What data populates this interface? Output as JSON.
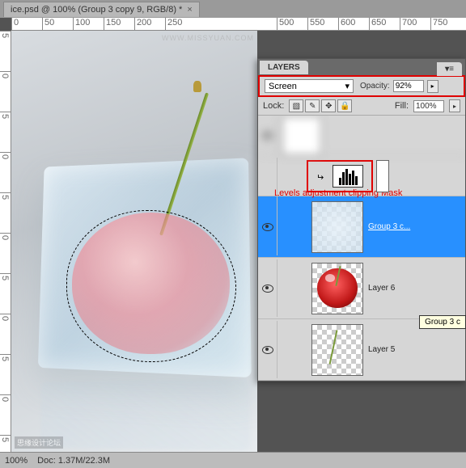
{
  "tab": {
    "title": "ice.psd @ 100% (Group 3 copy 9, RGB/8) *",
    "close": "×"
  },
  "ruler_h": [
    "0",
    "50",
    "100",
    "150",
    "200",
    "250",
    "500",
    "550",
    "600",
    "650",
    "700",
    "750"
  ],
  "ruler_v": [
    "5",
    "0",
    "5",
    "0",
    "5",
    "0",
    "5",
    "0",
    "5",
    "0",
    "5"
  ],
  "canvas": {
    "watermark": "思缘设计论坛",
    "watermark_url": "WWW.MISSYUAN.COM"
  },
  "status": {
    "zoom": "100%",
    "doc": "Doc: 1.37M/22.3M"
  },
  "layers_panel": {
    "title": "LAYERS",
    "blend_mode": "Screen",
    "opacity_label": "Opacity:",
    "opacity_value": "92%",
    "lock_label": "Lock:",
    "fill_label": "Fill:",
    "fill_value": "100%",
    "annotation": "Levels adjustment clipping Mask",
    "tooltip": "Group 3 c",
    "layers": [
      {
        "name": "",
        "type": "blurred"
      },
      {
        "name": "",
        "type": "blurred"
      },
      {
        "name": "",
        "type": "levels-clip"
      },
      {
        "name": "Group 3 c...",
        "type": "ice",
        "selected": true
      },
      {
        "name": "Layer 6",
        "type": "cherry"
      },
      {
        "name": "Layer 5",
        "type": "stem"
      }
    ]
  }
}
